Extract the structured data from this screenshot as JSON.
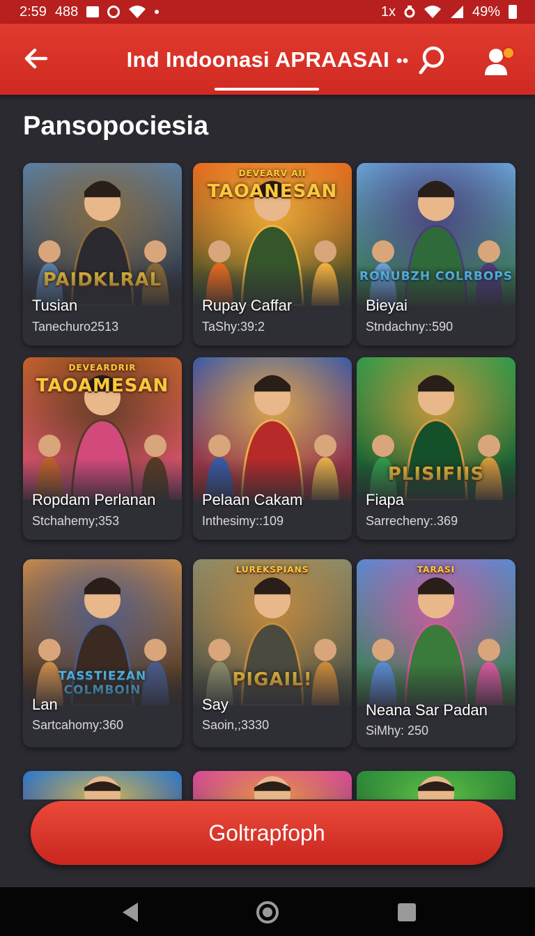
{
  "status_bar": {
    "time": "2:59",
    "notif_count": "488",
    "signal_text": "1x",
    "battery": "49%"
  },
  "app_bar": {
    "title": "Ind Indoonasi APRAASAI",
    "title_dots": "••",
    "icons": {
      "back": "arrow-left-icon",
      "search": "search-icon",
      "profile": "user-icon"
    }
  },
  "section": {
    "title": "Pansopociesia"
  },
  "games": [
    {
      "name": "Tusian",
      "sub": "Tanechuro2513",
      "art_text": "PAIDKLRAL",
      "palette": [
        "#5a7fa6",
        "#8a6a3a",
        "#2b2a30"
      ]
    },
    {
      "name": "Rupay Caffar",
      "sub": "TaShy:39:2",
      "art_top": "DEVEARV AII",
      "art_text": "TAOANESAN",
      "palette": [
        "#e86a1e",
        "#f4b23b",
        "#35552b"
      ]
    },
    {
      "name": "Bieyai",
      "sub": "Stndachny::590",
      "art_text": "RONUBZH COLRBOPS",
      "palette": [
        "#6aa2d8",
        "#4b3d7a",
        "#2f6b3a"
      ]
    },
    {
      "name": "Ropdam Perlanan",
      "sub": "Stchahemy;353",
      "art_top": "DEVEARDRIR",
      "art_text": "TAOAMESAN",
      "palette": [
        "#c2612a",
        "#5a3a24",
        "#d24a7c"
      ]
    },
    {
      "name": "Pelaan Cakam",
      "sub": "Inthesimy::109",
      "art_text": "",
      "palette": [
        "#3b5aa8",
        "#e8b04a",
        "#b62a2a"
      ]
    },
    {
      "name": "Fiapa",
      "sub": "Sarrecheny:.369",
      "art_text": "PLISIFIIS",
      "palette": [
        "#2f9a4a",
        "#d89a3c",
        "#14502a"
      ]
    },
    {
      "name": "Lan",
      "sub": "Sartcahomy:360",
      "art_text": "TASSTIEZAN COLMBOIN",
      "palette": [
        "#c88a4a",
        "#4a5a8a",
        "#3a2a22"
      ]
    },
    {
      "name": "Say",
      "sub": "Saoin,;3330",
      "art_top": "LUREKSPIANS",
      "art_text": "PIGAIL!",
      "palette": [
        "#8a8a6a",
        "#c88a3a",
        "#4a4a3e"
      ]
    },
    {
      "name": "Neana Sar Padan",
      "sub": "SiMhy: 250",
      "art_top": "TARASI",
      "art_text": "",
      "palette": [
        "#5a8ad0",
        "#d25a9a",
        "#3a7a3a"
      ]
    },
    {
      "name": "",
      "sub": "",
      "art_text": "",
      "palette": [
        "#2a7ad0",
        "#e8c34a",
        "#3a2a6a"
      ]
    },
    {
      "name": "",
      "sub": "",
      "art_text": "",
      "palette": [
        "#d84a9a",
        "#f4a23b",
        "#5a2a6a"
      ]
    },
    {
      "name": "",
      "sub": "",
      "art_text": "",
      "palette": [
        "#2a8a3a",
        "#6ad04a",
        "#123a1a"
      ]
    }
  ],
  "cta": {
    "label": "Goltrapfoph"
  },
  "nav": {
    "back": "triangle-back-icon",
    "home": "circle-home-icon",
    "recents": "square-recents-icon"
  }
}
